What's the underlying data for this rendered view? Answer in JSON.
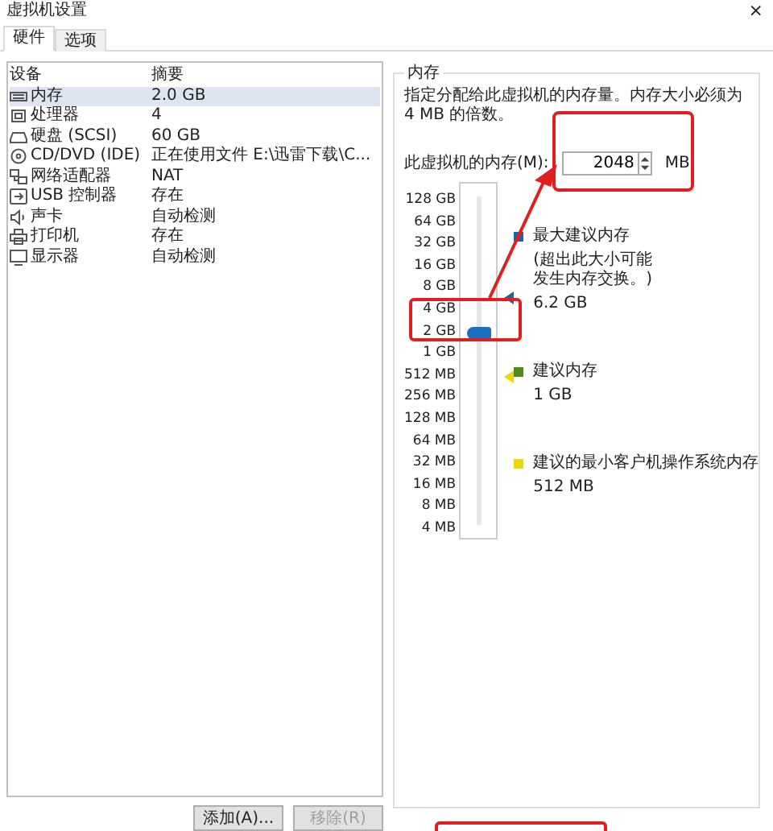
{
  "window": {
    "title": "虚拟机设置",
    "close": "×"
  },
  "tabs": [
    {
      "label": "硬件",
      "selected": true
    },
    {
      "label": "选项",
      "selected": false
    }
  ],
  "devices": {
    "columns": [
      "设备",
      "摘要"
    ],
    "rows": [
      {
        "kind": "memory",
        "name": "内存",
        "summary": "2.0 GB",
        "selected": true
      },
      {
        "kind": "cpu",
        "name": "处理器",
        "summary": "4",
        "selected": false
      },
      {
        "kind": "disk",
        "name": "硬盘 (SCSI)",
        "summary": "60 GB",
        "selected": false
      },
      {
        "kind": "cdrom",
        "name": "CD/DVD (IDE)",
        "summary": "正在使用文件 E:\\迅雷下载\\C...",
        "selected": false
      },
      {
        "kind": "network",
        "name": "网络适配器",
        "summary": "NAT",
        "selected": false
      },
      {
        "kind": "usb",
        "name": "USB 控制器",
        "summary": "存在",
        "selected": false
      },
      {
        "kind": "sound",
        "name": "声卡",
        "summary": "自动检测",
        "selected": false
      },
      {
        "kind": "printer",
        "name": "打印机",
        "summary": "存在",
        "selected": false
      },
      {
        "kind": "display",
        "name": "显示器",
        "summary": "自动检测",
        "selected": false
      }
    ]
  },
  "buttons": [
    {
      "label": "添加(A)...",
      "disabled": false
    },
    {
      "label": "移除(R)",
      "disabled": true
    }
  ],
  "memory": {
    "title": "内存",
    "description": "指定分配给此虚拟机的内存量。内存大小必须为 4 MB 的倍数。",
    "field_label": "此虚拟机的内存(M):",
    "value": "2048",
    "unit": "MB",
    "slider": {
      "ticks": [
        "128 GB",
        "64 GB",
        "32 GB",
        "16 GB",
        "8 GB",
        "4 GB",
        "2 GB",
        "1 GB",
        "512 MB",
        "256 MB",
        "128 MB",
        "64 MB",
        "32 MB",
        "16 MB",
        "8 MB",
        "4 MB"
      ],
      "level": 0.6
    },
    "legend": [
      {
        "label": "最大建议内存",
        "note": "(超出此大小可能发生内存交换。)",
        "value": "6.2 GB",
        "color": "#1c64a8"
      },
      {
        "label": "建议内存",
        "value": "1 GB",
        "color": "#4e8a1e"
      },
      {
        "label": "建议的最小客户机操作系统内存",
        "value": "512 MB",
        "color": "#f2d80a"
      }
    ]
  }
}
